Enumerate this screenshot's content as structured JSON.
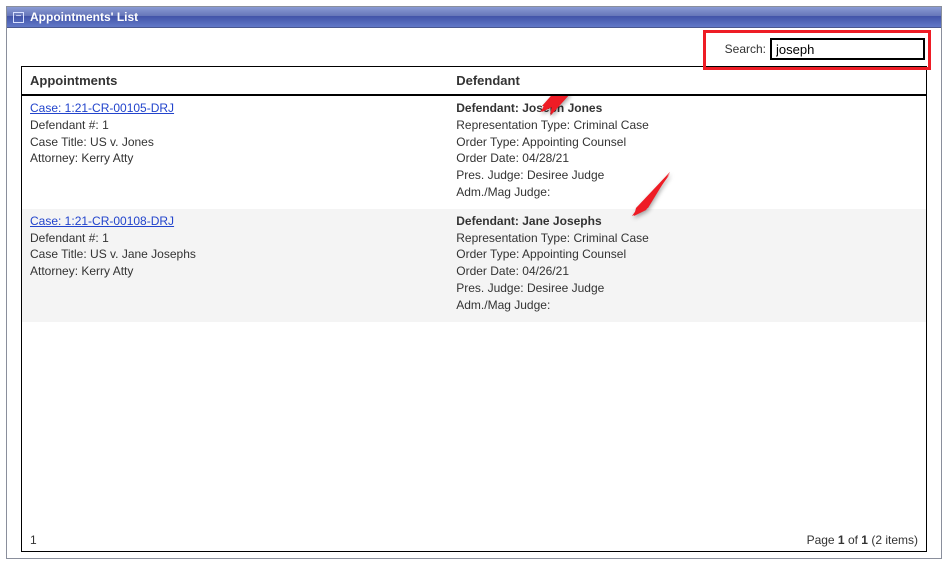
{
  "panel": {
    "title": "Appointments' List"
  },
  "search": {
    "label": "Search:",
    "value": "joseph"
  },
  "columns": {
    "appointments": "Appointments",
    "defendant": "Defendant"
  },
  "rows": [
    {
      "case_link": "Case: 1:21-CR-00105-DRJ",
      "defendant_num_label": "Defendant #:",
      "defendant_num": "1",
      "case_title_label": "Case Title:",
      "case_title": "US v. Jones",
      "attorney_label": "Attorney:",
      "attorney": "Kerry Atty",
      "def_name_label": "Defendant:",
      "def_name": "Joseph Jones",
      "rep_type_label": "Representation Type:",
      "rep_type": "Criminal Case",
      "order_type_label": "Order Type:",
      "order_type": "Appointing Counsel",
      "order_date_label": "Order Date:",
      "order_date": "04/28/21",
      "pres_judge_label": "Pres. Judge:",
      "pres_judge": "Desiree Judge",
      "adm_judge_label": "Adm./Mag Judge:",
      "adm_judge": ""
    },
    {
      "case_link": "Case: 1:21-CR-00108-DRJ",
      "defendant_num_label": "Defendant #:",
      "defendant_num": "1",
      "case_title_label": "Case Title:",
      "case_title": "US v. Jane Josephs",
      "attorney_label": "Attorney:",
      "attorney": "Kerry Atty",
      "def_name_label": "Defendant:",
      "def_name": "Jane Josephs",
      "rep_type_label": "Representation Type:",
      "rep_type": "Criminal Case",
      "order_type_label": "Order Type:",
      "order_type": "Appointing Counsel",
      "order_date_label": "Order Date:",
      "order_date": "04/26/21",
      "pres_judge_label": "Pres. Judge:",
      "pres_judge": "Desiree Judge",
      "adm_judge_label": "Adm./Mag Judge:",
      "adm_judge": ""
    }
  ],
  "pager": {
    "current_page_link": "1",
    "label_prefix": "Page ",
    "current": "1",
    "of_label": " of ",
    "total": "1",
    "items_label": " (2 items)"
  }
}
